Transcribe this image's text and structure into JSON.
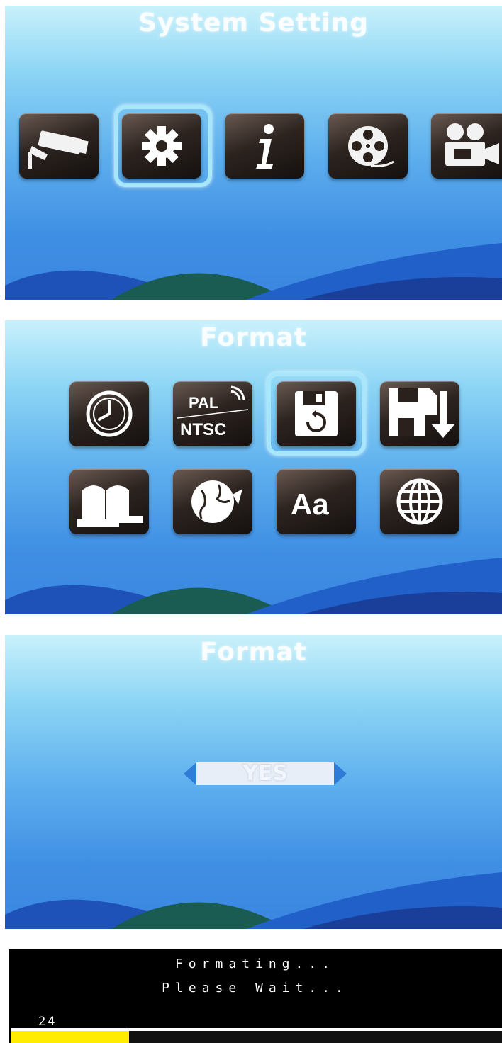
{
  "screens": {
    "system_setting": {
      "title": "System Setting",
      "icons": [
        "camera-icon",
        "gear-icon",
        "info-icon",
        "film-reel-icon",
        "movie-camera-icon"
      ],
      "selected_index": 1
    },
    "format_menu": {
      "title": "Format",
      "icons": [
        "clock-icon",
        "pal-ntsc-icon",
        "floppy-format-icon",
        "floppy-download-icon",
        "storage-icon",
        "world-map-icon",
        "font-size-icon",
        "globe-icon"
      ],
      "pal_label": "PAL",
      "ntsc_label": "NTSC",
      "font_label": "Aa",
      "selected_index": 2
    },
    "format_confirm": {
      "title": "Format",
      "option": "YES"
    },
    "formatting": {
      "line1": "Formating...",
      "line2": "Please Wait...",
      "progress_value": "24",
      "progress_fraction": 0.24
    }
  },
  "colors": {
    "selection_border": "#a8e7fb",
    "progress_fill": "#ffec00",
    "arrow": "#2f7bd8"
  }
}
